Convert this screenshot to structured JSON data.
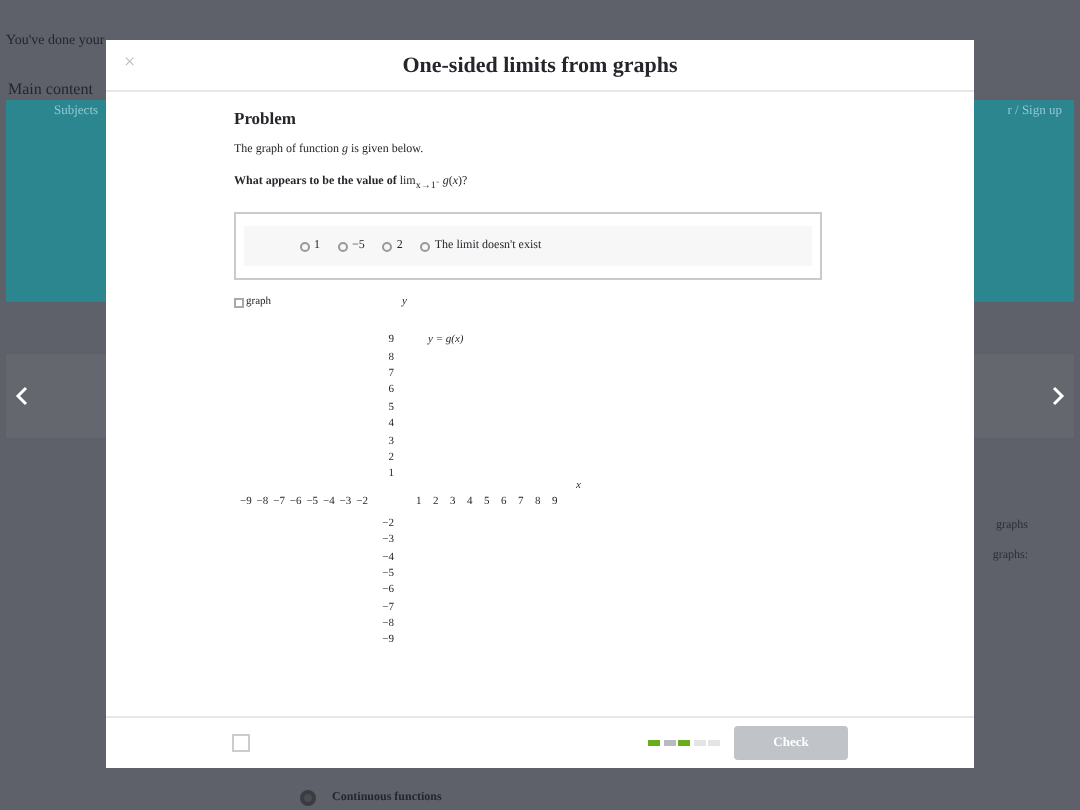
{
  "background_page": {
    "notice": "You've done your",
    "main_content_label": "Main content",
    "banner": {
      "left_text": "Subjects",
      "right_text": "r / Sign up"
    },
    "side_texts": [
      "graphs",
      "graphs:"
    ],
    "timeline_item": "Continuous functions"
  },
  "modal": {
    "close": "×",
    "title": "One-sided limits from graphs",
    "problem": {
      "heading": "Problem",
      "intro": "The graph of function *g* is given below.",
      "question": "**What appears to be the value of** lim$_{x→1⁻}$ *g*(*x*)?",
      "options": [
        {
          "label": "1",
          "selected": false
        },
        {
          "label": "−5",
          "selected": false
        },
        {
          "label": "2",
          "selected": false
        },
        {
          "label": "The limit doesn't exist",
          "selected": false
        }
      ]
    },
    "graph": {
      "image_alt": "graph",
      "y_axis_label": "y",
      "x_axis_label": "x",
      "curve_label": "y = g(x)",
      "y_ticks_positive": [
        "9",
        "8",
        "7",
        "6",
        "5",
        "4",
        "3",
        "2",
        "1"
      ],
      "y_ticks_negative": [
        "−2",
        "−3",
        "−4",
        "−5",
        "−6",
        "−7",
        "−8",
        "−9"
      ],
      "x_ticks_negative": [
        "−9",
        "−8",
        "−7",
        "−6",
        "−5",
        "−4",
        "−3",
        "−2"
      ],
      "x_ticks_positive": [
        "1",
        "2",
        "3",
        "4",
        "5",
        "6",
        "7",
        "8",
        "9"
      ]
    },
    "footer": {
      "progress": [
        {
          "color": "#6aad1c"
        },
        {
          "color": "#b7babf"
        },
        {
          "color": "#6aad1c"
        },
        {
          "color": "#e3e4e6"
        },
        {
          "color": "#e3e4e6"
        }
      ],
      "check_button": {
        "label": "Check",
        "disabled": true
      }
    }
  }
}
